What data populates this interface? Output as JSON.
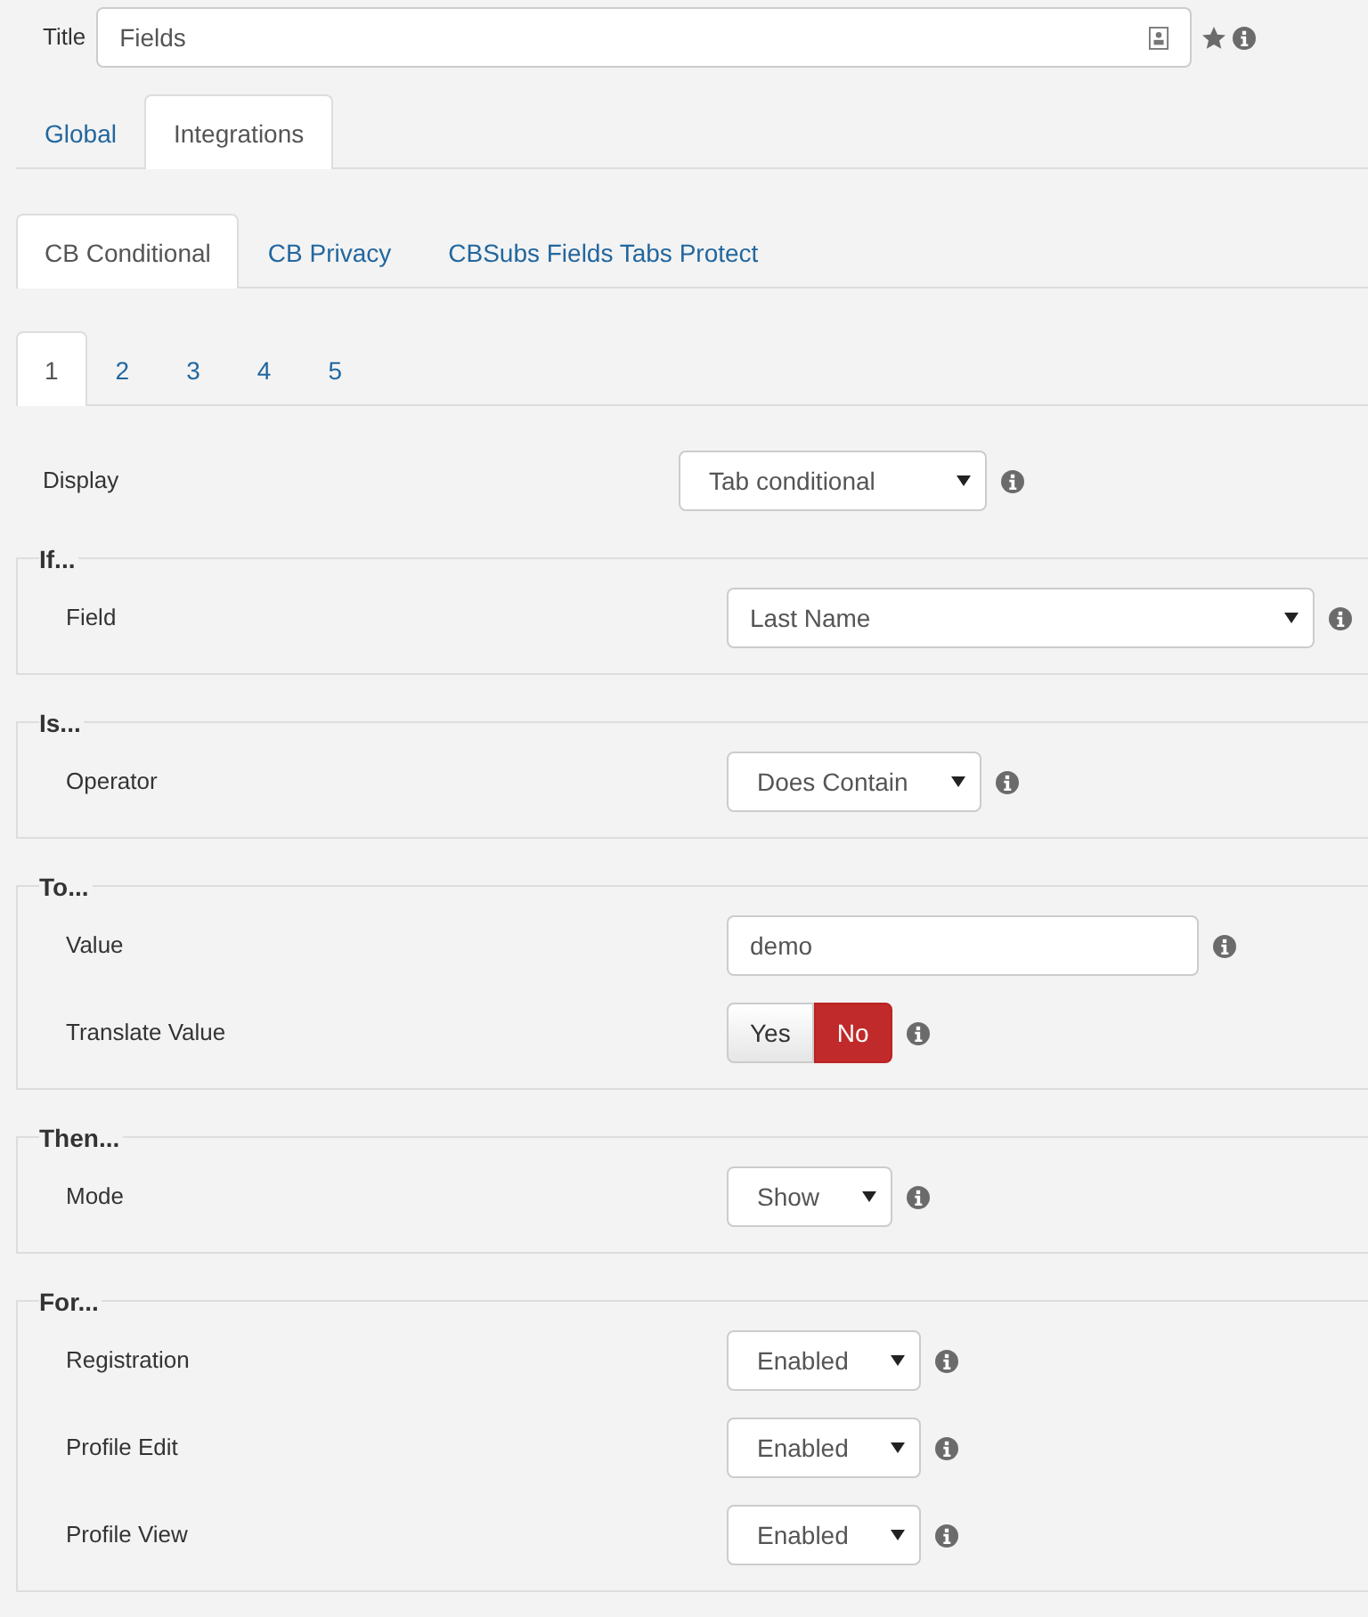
{
  "title_field": {
    "label": "Title",
    "value": "Fields"
  },
  "tabs": [
    {
      "label": "Global",
      "selected": false
    },
    {
      "label": "Integrations",
      "selected": true
    }
  ],
  "subtabs": [
    {
      "label": "CB Conditional",
      "selected": true
    },
    {
      "label": "CB Privacy",
      "selected": false
    },
    {
      "label": "CBSubs Fields Tabs Protect",
      "selected": false
    }
  ],
  "number_tabs": [
    {
      "label": "1",
      "selected": true
    },
    {
      "label": "2",
      "selected": false
    },
    {
      "label": "3",
      "selected": false
    },
    {
      "label": "4",
      "selected": false
    },
    {
      "label": "5",
      "selected": false
    }
  ],
  "display": {
    "label": "Display",
    "kind": "select",
    "value": "Tab conditional"
  },
  "sections": [
    {
      "legend": "If...",
      "rows": [
        {
          "label": "Field",
          "kind": "combo",
          "value": "Last Name"
        }
      ]
    },
    {
      "legend": "Is...",
      "rows": [
        {
          "label": "Operator",
          "kind": "select",
          "value": "Does Contain"
        }
      ]
    },
    {
      "legend": "To...",
      "rows": [
        {
          "label": "Value",
          "kind": "text",
          "value": "demo"
        },
        {
          "label": "Translate Value",
          "kind": "toggle",
          "options": [
            {
              "label": "Yes",
              "selected": false
            },
            {
              "label": "No",
              "selected": true
            }
          ]
        }
      ]
    },
    {
      "legend": "Then...",
      "rows": [
        {
          "label": "Mode",
          "kind": "select",
          "value": "Show"
        }
      ]
    },
    {
      "legend": "For...",
      "rows": [
        {
          "label": "Registration",
          "kind": "select",
          "value": "Enabled"
        },
        {
          "label": "Profile Edit",
          "kind": "select",
          "value": "Enabled"
        },
        {
          "label": "Profile View",
          "kind": "select",
          "value": "Enabled"
        }
      ]
    }
  ]
}
